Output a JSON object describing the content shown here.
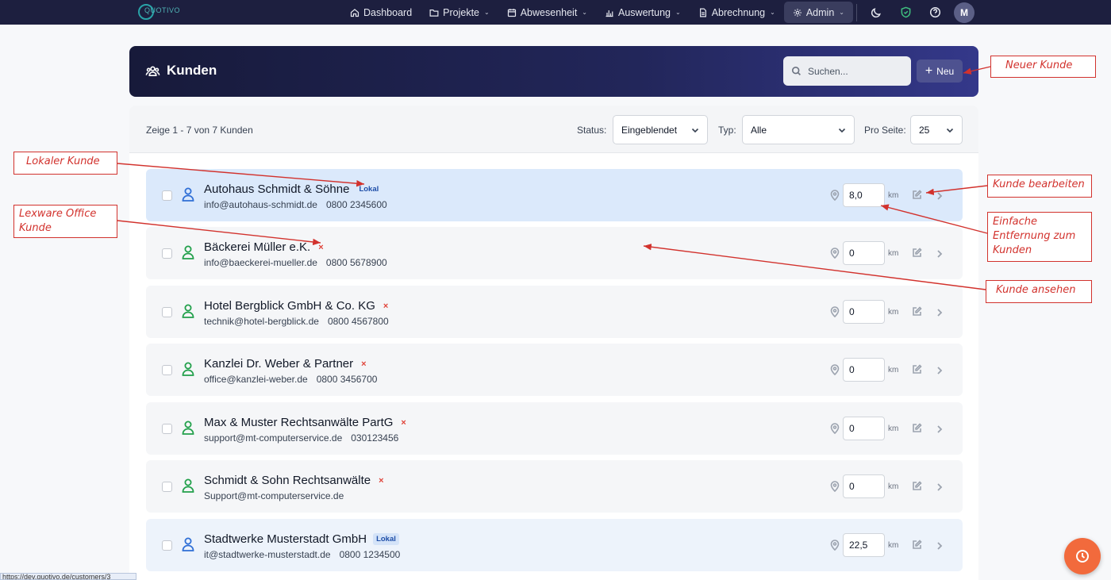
{
  "nav": {
    "logo_text": "QUOTIVO",
    "items": [
      {
        "label": "Dashboard",
        "icon": "home-icon",
        "has_chevron": false
      },
      {
        "label": "Projekte",
        "icon": "folder-icon",
        "has_chevron": true
      },
      {
        "label": "Abwesenheit",
        "icon": "calendar-icon",
        "has_chevron": true
      },
      {
        "label": "Auswertung",
        "icon": "bar-chart-icon",
        "has_chevron": true
      },
      {
        "label": "Abrechnung",
        "icon": "document-icon",
        "has_chevron": true
      },
      {
        "label": "Admin",
        "icon": "gear-icon",
        "has_chevron": true,
        "active": true
      }
    ],
    "avatar_initial": "M"
  },
  "header": {
    "title": "Kunden",
    "search_placeholder": "Suchen...",
    "new_button": "Neu"
  },
  "filters": {
    "count_text": "Zeige 1 - 7 von 7 Kunden",
    "status_label": "Status:",
    "status_value": "Eingeblendet",
    "type_label": "Typ:",
    "type_value": "Alle",
    "per_page_label": "Pro Seite:",
    "per_page_value": "25"
  },
  "customers": [
    {
      "name": "Autohaus Schmidt & Söhne",
      "email": "info@autohaus-schmidt.de",
      "phone": "0800 2345600",
      "distance": "8,0",
      "unit": "km",
      "local": true,
      "badge": "Lokal"
    },
    {
      "name": "Bäckerei Müller e.K.",
      "email": "info@baeckerei-mueller.de",
      "phone": "0800 5678900",
      "distance": "0",
      "unit": "km",
      "local": false,
      "badge": "×"
    },
    {
      "name": "Hotel Bergblick GmbH & Co. KG",
      "email": "technik@hotel-bergblick.de",
      "phone": "0800 4567800",
      "distance": "0",
      "unit": "km",
      "local": false,
      "badge": "×"
    },
    {
      "name": "Kanzlei Dr. Weber & Partner",
      "email": "office@kanzlei-weber.de",
      "phone": "0800 3456700",
      "distance": "0",
      "unit": "km",
      "local": false,
      "badge": "×"
    },
    {
      "name": "Max & Muster Rechtsanwälte PartG",
      "email": "support@mt-computerservice.de",
      "phone": "030123456",
      "distance": "0",
      "unit": "km",
      "local": false,
      "badge": "×"
    },
    {
      "name": "Schmidt & Sohn Rechtsanwälte",
      "email": "Support@mt-computerservice.de",
      "phone": "",
      "distance": "0",
      "unit": "km",
      "local": false,
      "badge": "×"
    },
    {
      "name": "Stadtwerke Musterstadt GmbH",
      "email": "it@stadtwerke-musterstadt.de",
      "phone": "0800 1234500",
      "distance": "22,5",
      "unit": "km",
      "local": true,
      "badge": "Lokal"
    }
  ],
  "annotations": {
    "neuer_kunde": "Neuer Kunde",
    "lokaler_kunde": "Lokaler Kunde",
    "lexware_line1": "Lexware Office",
    "lexware_line2": "Kunde",
    "kunde_bearbeiten": "Kunde bearbeiten",
    "entfernung_line1": "Einfache",
    "entfernung_line2": "Entfernung zum",
    "entfernung_line3": "Kunden",
    "kunde_ansehen": "Kunde ansehen"
  },
  "status_bar_url": "https://dev.quotivo.de/customers/3",
  "colors": {
    "nav_bg": "#1d1f3f",
    "accent": "#4e5290",
    "annotation_red": "#d2322d",
    "local_blue": "#2f6fd6",
    "lexware_green": "#22a04b",
    "fab_orange": "#f26a3c"
  }
}
